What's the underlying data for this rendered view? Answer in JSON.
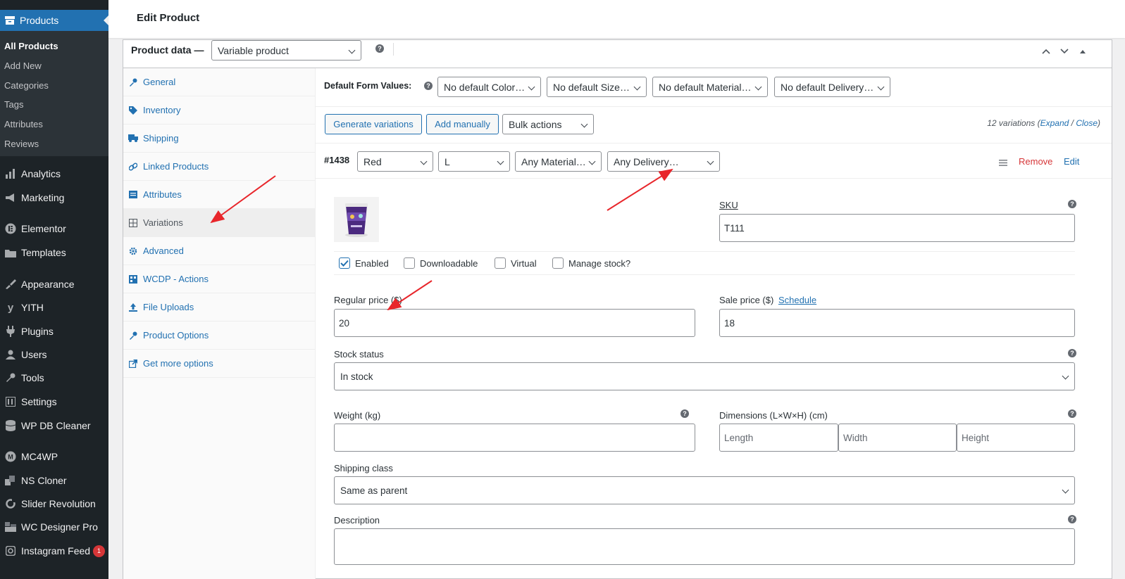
{
  "sidebar": {
    "products_label": "Products",
    "submenu": [
      "All Products",
      "Add New",
      "Categories",
      "Tags",
      "Attributes",
      "Reviews"
    ],
    "items": [
      {
        "label": "Analytics",
        "icon": "bar-chart-icon"
      },
      {
        "label": "Marketing",
        "icon": "megaphone-icon"
      },
      {
        "label": "Elementor",
        "icon": "elementor-icon"
      },
      {
        "label": "Templates",
        "icon": "folder-icon"
      },
      {
        "label": "Appearance",
        "icon": "paintbrush-icon"
      },
      {
        "label": "YITH",
        "icon": "yith-icon"
      },
      {
        "label": "Plugins",
        "icon": "plug-icon"
      },
      {
        "label": "Users",
        "icon": "user-icon"
      },
      {
        "label": "Tools",
        "icon": "wrench-icon"
      },
      {
        "label": "Settings",
        "icon": "sliders-icon"
      },
      {
        "label": "WP DB Cleaner",
        "icon": "database-icon"
      },
      {
        "label": "MC4WP",
        "icon": "mc4wp-icon"
      },
      {
        "label": "NS Cloner",
        "icon": "cloner-icon"
      },
      {
        "label": "Slider Revolution",
        "icon": "refresh-icon"
      },
      {
        "label": "WC Designer Pro",
        "icon": "designer-icon"
      },
      {
        "label": "Instagram Feed",
        "icon": "instagram-icon",
        "badge": "1"
      }
    ]
  },
  "header": {
    "title": "Edit Product"
  },
  "product_data": {
    "label": "Product data —",
    "type_value": "Variable product",
    "tabs": [
      "General",
      "Inventory",
      "Shipping",
      "Linked Products",
      "Attributes",
      "Variations",
      "Advanced",
      "WCDP - Actions",
      "File Uploads",
      "Product Options",
      "Get more options"
    ],
    "active_tab": "Variations"
  },
  "variations": {
    "default_form_label": "Default Form Values:",
    "defaults": [
      "No default Color…",
      "No default Size…",
      "No default Material…",
      "No default Delivery…"
    ],
    "generate_label": "Generate variations",
    "add_manually_label": "Add manually",
    "bulk_actions_label": "Bulk actions",
    "count_text": "12 variations (",
    "expand_label": "Expand",
    "separator": " / ",
    "close_label": "Close",
    "count_end": ")",
    "variation": {
      "id": "#1438",
      "attributes": [
        "Red",
        "L",
        "Any Material…",
        "Any Delivery…"
      ],
      "remove_label": "Remove",
      "edit_label": "Edit",
      "sku_label": "SKU",
      "sku_value": "T111",
      "checkboxes": [
        {
          "label": "Enabled",
          "checked": true
        },
        {
          "label": "Downloadable",
          "checked": false
        },
        {
          "label": "Virtual",
          "checked": false
        },
        {
          "label": "Manage stock?",
          "checked": false
        }
      ],
      "regular_price_label": "Regular price ($)",
      "regular_price_value": "20",
      "sale_price_label": "Sale price ($)",
      "schedule_label": "Schedule",
      "sale_price_value": "18",
      "stock_status_label": "Stock status",
      "stock_status_value": "In stock",
      "weight_label": "Weight (kg)",
      "weight_value": "",
      "dimensions_label": "Dimensions (L×W×H) (cm)",
      "length_placeholder": "Length",
      "width_placeholder": "Width",
      "height_placeholder": "Height",
      "shipping_class_label": "Shipping class",
      "shipping_class_value": "Same as parent",
      "description_label": "Description"
    }
  },
  "colors": {
    "accent": "#2271b1",
    "sidebar_bg": "#1d2327",
    "danger": "#d63638",
    "annotation": "#e8262b"
  }
}
